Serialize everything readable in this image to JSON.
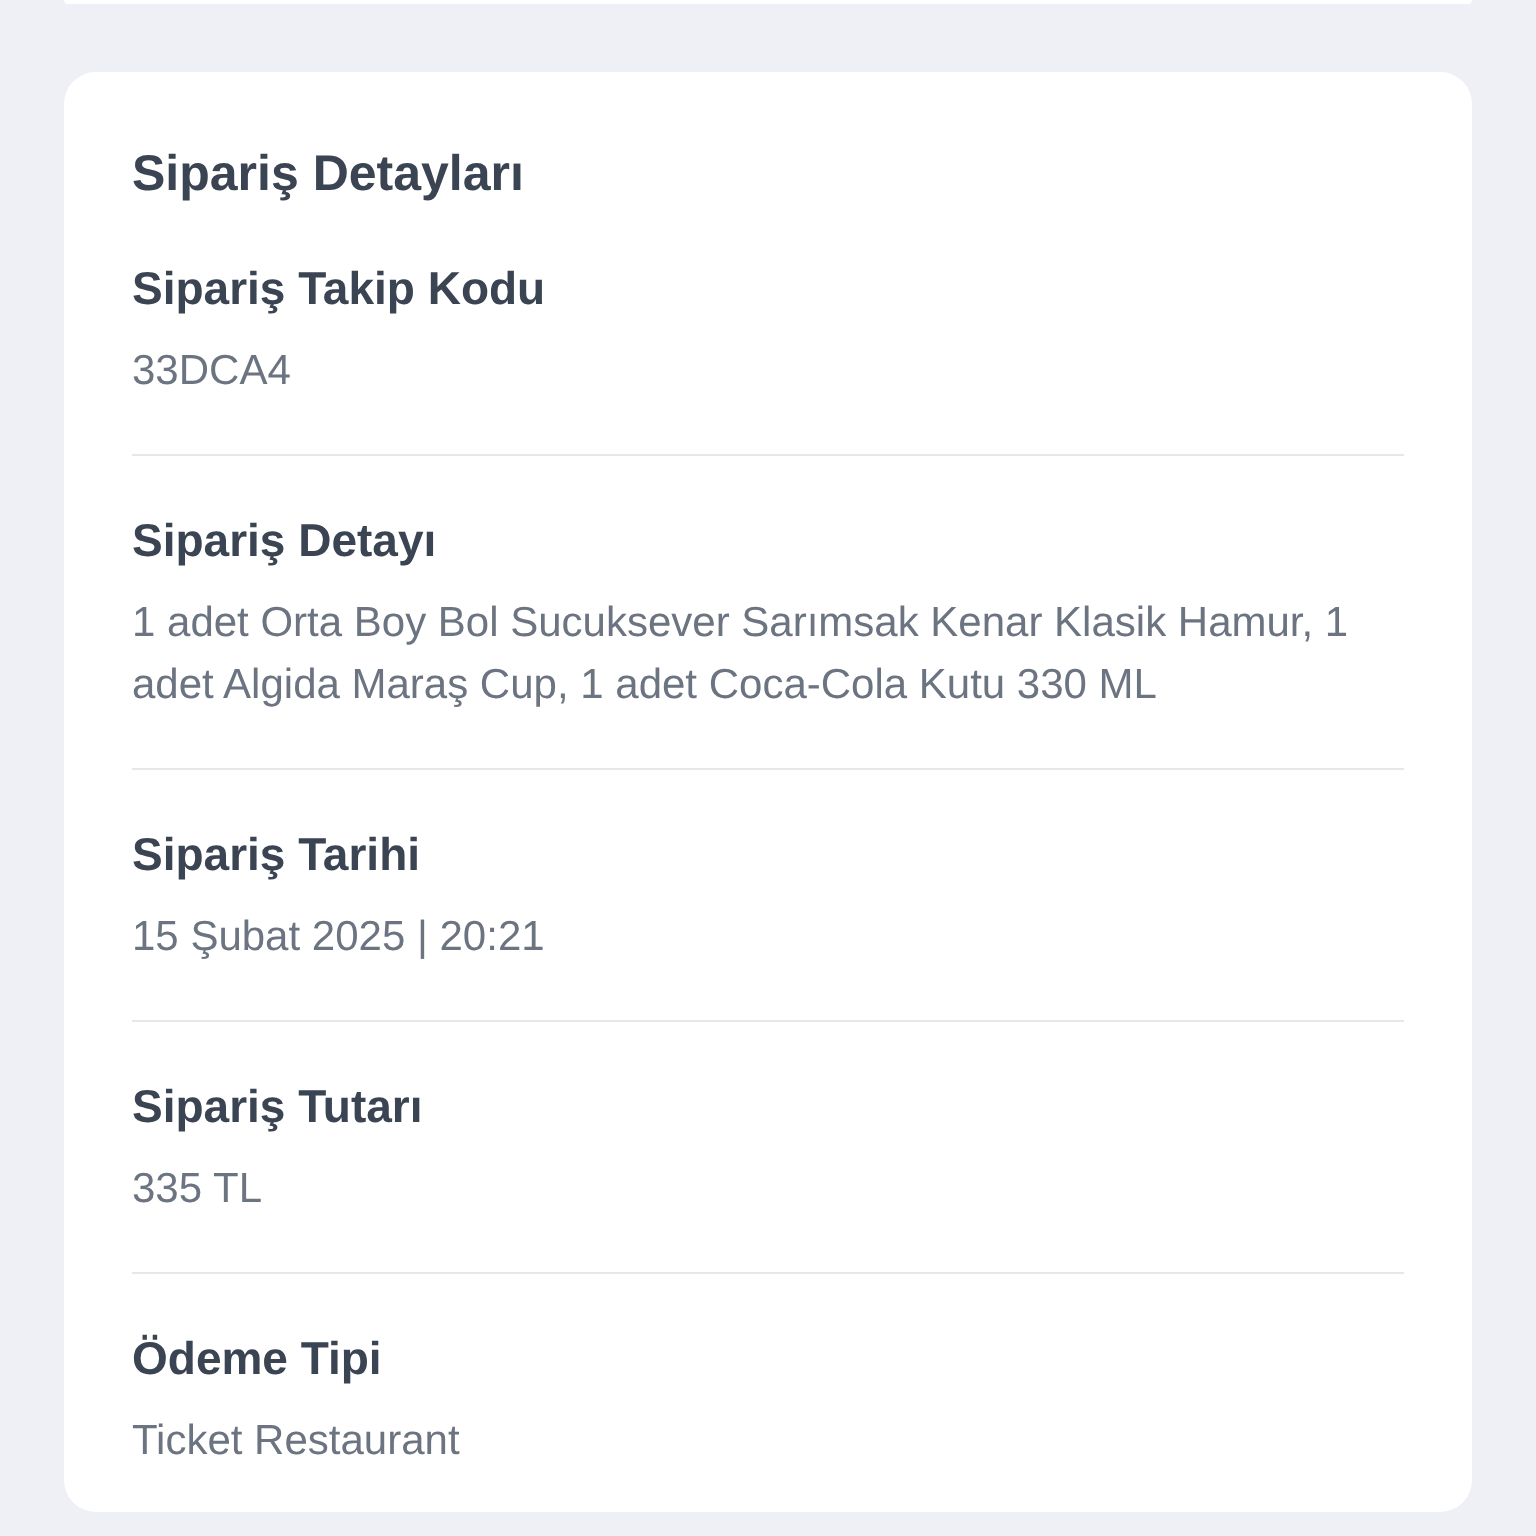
{
  "card": {
    "title": "Sipariş Detayları",
    "fields": [
      {
        "label": "Sipariş Takip Kodu",
        "value": "33DCA4"
      },
      {
        "label": "Sipariş Detayı",
        "value": "1 adet Orta Boy Bol Sucuksever Sarımsak Kenar Klasik Hamur, 1 adet Algida Maraş Cup, 1 adet Coca-Cola Kutu 330 ML"
      },
      {
        "label": "Sipariş Tarihi",
        "value": "15 Şubat 2025 | 20:21"
      },
      {
        "label": "Sipariş Tutarı",
        "value": "335 TL"
      },
      {
        "label": "Ödeme Tipi",
        "value": "Ticket Restaurant"
      }
    ]
  }
}
